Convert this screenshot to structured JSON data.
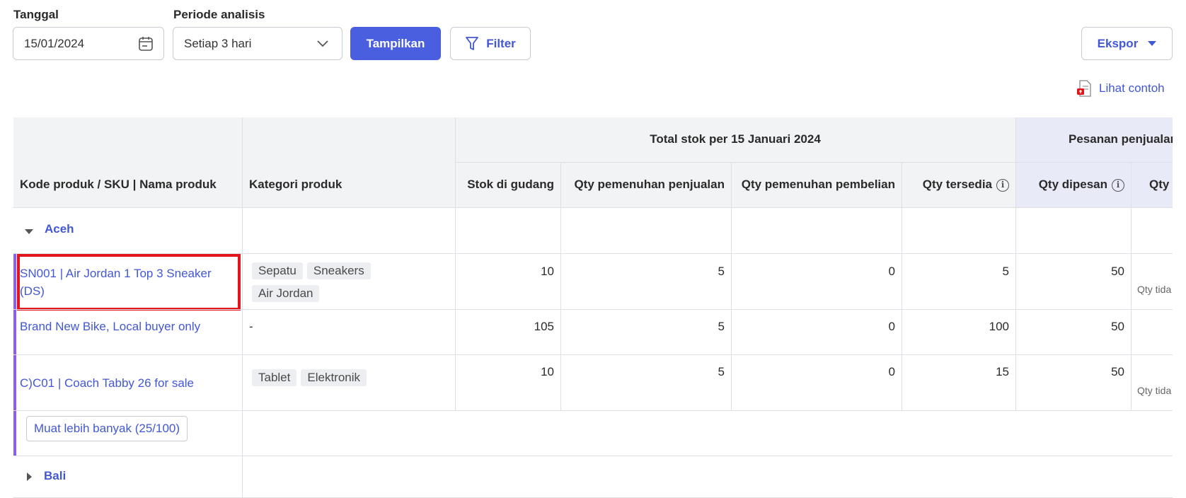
{
  "toolbar": {
    "date_label": "Tanggal",
    "date_value": "15/01/2024",
    "period_label": "Periode analisis",
    "period_value": "Setiap 3 hari",
    "show_button": "Tampilkan",
    "filter_button": "Filter",
    "export_button": "Ekspor",
    "sample_link": "Lihat contoh"
  },
  "table": {
    "group_header_total": "Total stok per 15 Januari 2024",
    "group_header_orders": "Pesanan penjualan",
    "columns": {
      "product": "Kode produk / SKU | Nama produk",
      "category": "Kategori produk",
      "warehouse_stock": "Stok di gudang",
      "sales_fulfillment": "Qty pemenuhan penjualan",
      "purchase_fulfillment": "Qty pemenuhan pembelian",
      "available": "Qty tersedia",
      "ordered": "Qty dipesan",
      "partial": "Qty te"
    },
    "groups": [
      {
        "name": "Aceh",
        "rows": [
          {
            "product": "SN001 | Air Jordan 1 Top 3 Sneaker (DS)",
            "tags": [
              "Sepatu",
              "Sneakers",
              "Air Jordan"
            ],
            "stock": "10",
            "sales_fulfillment": "5",
            "purchase_fulfillment": "0",
            "available": "5",
            "ordered": "50",
            "extra": "Qty tida"
          },
          {
            "product": "Brand New Bike, Local buyer only",
            "category": "-",
            "stock": "105",
            "sales_fulfillment": "5",
            "purchase_fulfillment": "0",
            "available": "100",
            "ordered": "50",
            "extra": ""
          },
          {
            "product": "C)C01 | Coach Tabby 26 for sale",
            "tags": [
              "Tablet",
              "Elektronik"
            ],
            "stock": "10",
            "sales_fulfillment": "5",
            "purchase_fulfillment": "0",
            "available": "15",
            "ordered": "50",
            "extra": "Qty tida"
          }
        ],
        "load_more": "Muat lebih banyak (25/100)"
      },
      {
        "name": "Bali"
      }
    ]
  },
  "colors": {
    "accent": "#4a5ee0",
    "link": "#4257d6",
    "highlight_box": "#e0161b",
    "group_bar": "#8b5cf6"
  }
}
